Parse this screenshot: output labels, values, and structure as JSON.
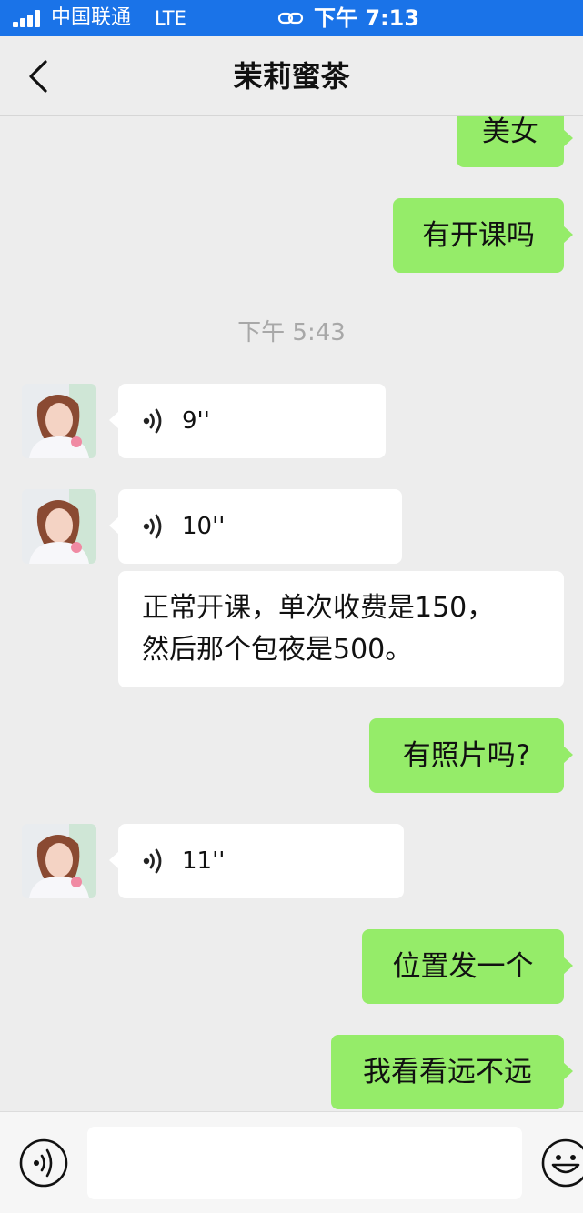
{
  "status_bar": {
    "carrier": "中国联通",
    "network": "LTE",
    "time": "下午 7:13",
    "icons": [
      "signal-icon",
      "link-icon"
    ]
  },
  "nav": {
    "title": "茉莉蜜茶",
    "back_icon": "chevron-left-icon"
  },
  "messages": {
    "m1": {
      "direction": "out",
      "text": "美女"
    },
    "m2": {
      "direction": "out",
      "text": "有开课吗"
    },
    "timestamp": "下午 5:43",
    "m3": {
      "direction": "in",
      "type": "voice",
      "duration": "9''"
    },
    "m4": {
      "direction": "in",
      "type": "voice",
      "duration": "10''"
    },
    "m5": {
      "direction": "in",
      "text": "正常开课，单次收费是150，\n然后那个包夜是500。"
    },
    "m6": {
      "direction": "out",
      "text": "有照片吗?"
    },
    "m7": {
      "direction": "in",
      "type": "voice",
      "duration": "11''"
    },
    "m8": {
      "direction": "out",
      "text": "位置发一个"
    },
    "m9": {
      "direction": "out",
      "text": "我看看远不远"
    }
  },
  "input_bar": {
    "voice_icon": "voice-mode-icon",
    "emoji_icon": "emoji-icon",
    "placeholder": ""
  },
  "colors": {
    "status_bar": "#1a73e8",
    "background": "#ededed",
    "outgoing_bubble": "#95ec69",
    "incoming_bubble": "#ffffff",
    "timestamp_text": "#a8a8a8"
  }
}
